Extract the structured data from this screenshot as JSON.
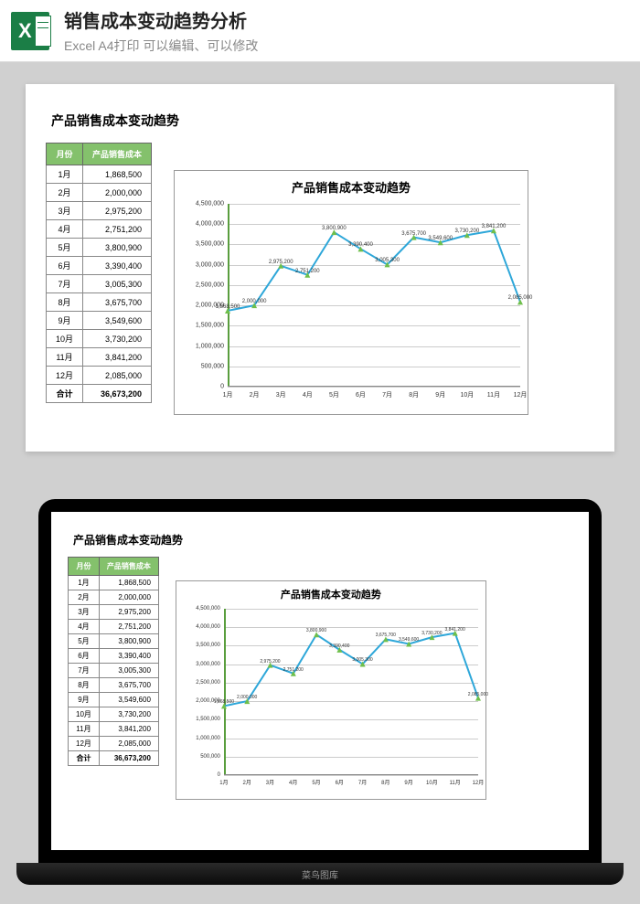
{
  "header": {
    "title": "销售成本变动趋势分析",
    "subtitle": "Excel A4打印 可以编辑、可以修改"
  },
  "section_title": "产品销售成本变动趋势",
  "table": {
    "col_month": "月份",
    "col_cost": "产品销售成本",
    "total_label": "合计",
    "total_value": "36,673,200",
    "rows": [
      {
        "month": "1月",
        "cost": "1,868,500"
      },
      {
        "month": "2月",
        "cost": "2,000,000"
      },
      {
        "month": "3月",
        "cost": "2,975,200"
      },
      {
        "month": "4月",
        "cost": "2,751,200"
      },
      {
        "month": "5月",
        "cost": "3,800,900"
      },
      {
        "month": "6月",
        "cost": "3,390,400"
      },
      {
        "month": "7月",
        "cost": "3,005,300"
      },
      {
        "month": "8月",
        "cost": "3,675,700"
      },
      {
        "month": "9月",
        "cost": "3,549,600"
      },
      {
        "month": "10月",
        "cost": "3,730,200"
      },
      {
        "month": "11月",
        "cost": "3,841,200"
      },
      {
        "month": "12月",
        "cost": "2,085,000"
      }
    ]
  },
  "chart_data": {
    "type": "line",
    "title": "产品销售成本变动趋势",
    "xlabel": "",
    "ylabel": "",
    "ylim": [
      0,
      4500000
    ],
    "y_ticks": [
      "0",
      "500,000",
      "1,000,000",
      "1,500,000",
      "2,000,000",
      "2,500,000",
      "3,000,000",
      "3,500,000",
      "4,000,000",
      "4,500,000"
    ],
    "categories": [
      "1月",
      "2月",
      "3月",
      "4月",
      "5月",
      "6月",
      "7月",
      "8月",
      "9月",
      "10月",
      "11月",
      "12月"
    ],
    "series": [
      {
        "name": "产品销售成本",
        "values": [
          1868500,
          2000000,
          2975200,
          2751200,
          3800900,
          3390400,
          3005300,
          3675700,
          3549600,
          3730200,
          3841200,
          2085000
        ],
        "color": "#2ea7d9",
        "marker_color": "#6fbf4b",
        "data_labels": [
          "1,868,500",
          "2,000,000",
          "2,975,200",
          "2,751,200",
          "3,800,900",
          "3,390,400",
          "3,005,300",
          "3,675,700",
          "3,549,600",
          "3,730,200",
          "3,841,200",
          "2,085,000"
        ]
      }
    ]
  },
  "laptop_footer": "菜鸟图库",
  "colors": {
    "header_green": "#84c16c",
    "axis_green": "#5a9e3e",
    "line_blue": "#2ea7d9"
  }
}
